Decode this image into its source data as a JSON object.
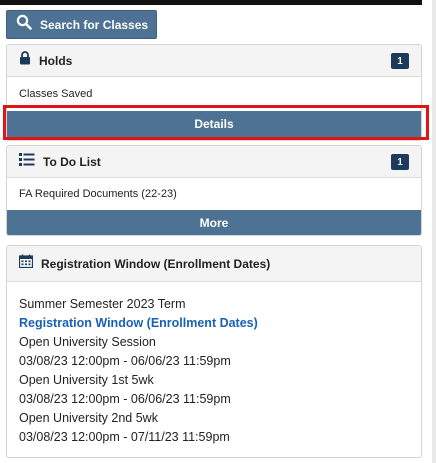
{
  "search": {
    "label": "Search for Classes"
  },
  "holds": {
    "title": "Holds",
    "count": "1",
    "item": "Classes Saved",
    "details_label": "Details"
  },
  "todo": {
    "title": "To Do List",
    "count": "1",
    "item": "FA Required Documents (22-23)",
    "more_label": "More"
  },
  "registration": {
    "header": "Registration Window (Enrollment Dates)",
    "term": "Summer Semester 2023 Term",
    "link": "Registration Window (Enrollment Dates)",
    "sessions": [
      {
        "name": "Open University Session",
        "dates": "03/08/23 12:00pm - 06/06/23 11:59pm"
      },
      {
        "name": "Open University 1st 5wk",
        "dates": "03/08/23 12:00pm - 06/06/23 11:59pm"
      },
      {
        "name": "Open University 2nd 5wk",
        "dates": "03/08/23 12:00pm - 07/11/23 11:59pm"
      }
    ]
  },
  "colors": {
    "button": "#4d7293",
    "badge": "#1b3a5c",
    "link": "#1a61b5",
    "highlight": "#e01616"
  },
  "icons": [
    "search-icon",
    "lock-icon",
    "list-icon",
    "calendar-icon"
  ]
}
